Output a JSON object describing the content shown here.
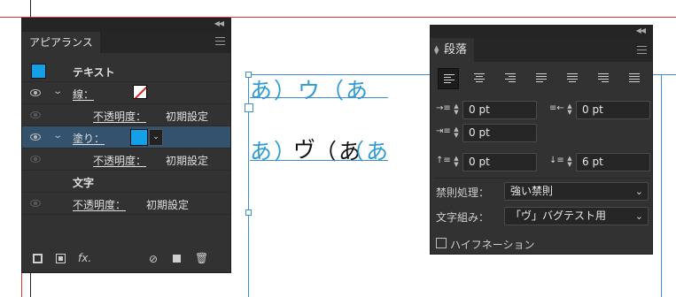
{
  "appearance_panel": {
    "tab_label": "アピアランス",
    "rows": {
      "text_label": "テキスト",
      "stroke_label": "線：",
      "stroke_opacity_label": "不透明度：",
      "stroke_opacity_value": "初期設定",
      "fill_label": "塗り：",
      "fill_opacity_label": "不透明度：",
      "fill_opacity_value": "初期設定",
      "characters_label": "文字",
      "opacity_label": "不透明度：",
      "opacity_value": "初期設定"
    },
    "fill_color": "#14a0e6",
    "bottom_fx": "fx."
  },
  "paragraph_panel": {
    "tab_label": "段落",
    "align_selected": "align-left",
    "left_indent": "0 pt",
    "right_indent": "0 pt",
    "first_line_indent": "0 pt",
    "space_before": "0 pt",
    "space_after": "6 pt",
    "kinsoku_label": "禁則処理：",
    "kinsoku_value": "強い禁則",
    "mojikumi_label": "文字組み：",
    "mojikumi_value": "「ヴ」バグテスト用",
    "hyphenation_label": "ハイフネーション"
  },
  "canvas": {
    "line1": "あ）ウ（あ",
    "line2_left": "あ）",
    "line2_vu": "ヴ",
    "line2_black": "（あ",
    "line2_right": "（あ",
    "text_color": "#2e9bd6"
  }
}
